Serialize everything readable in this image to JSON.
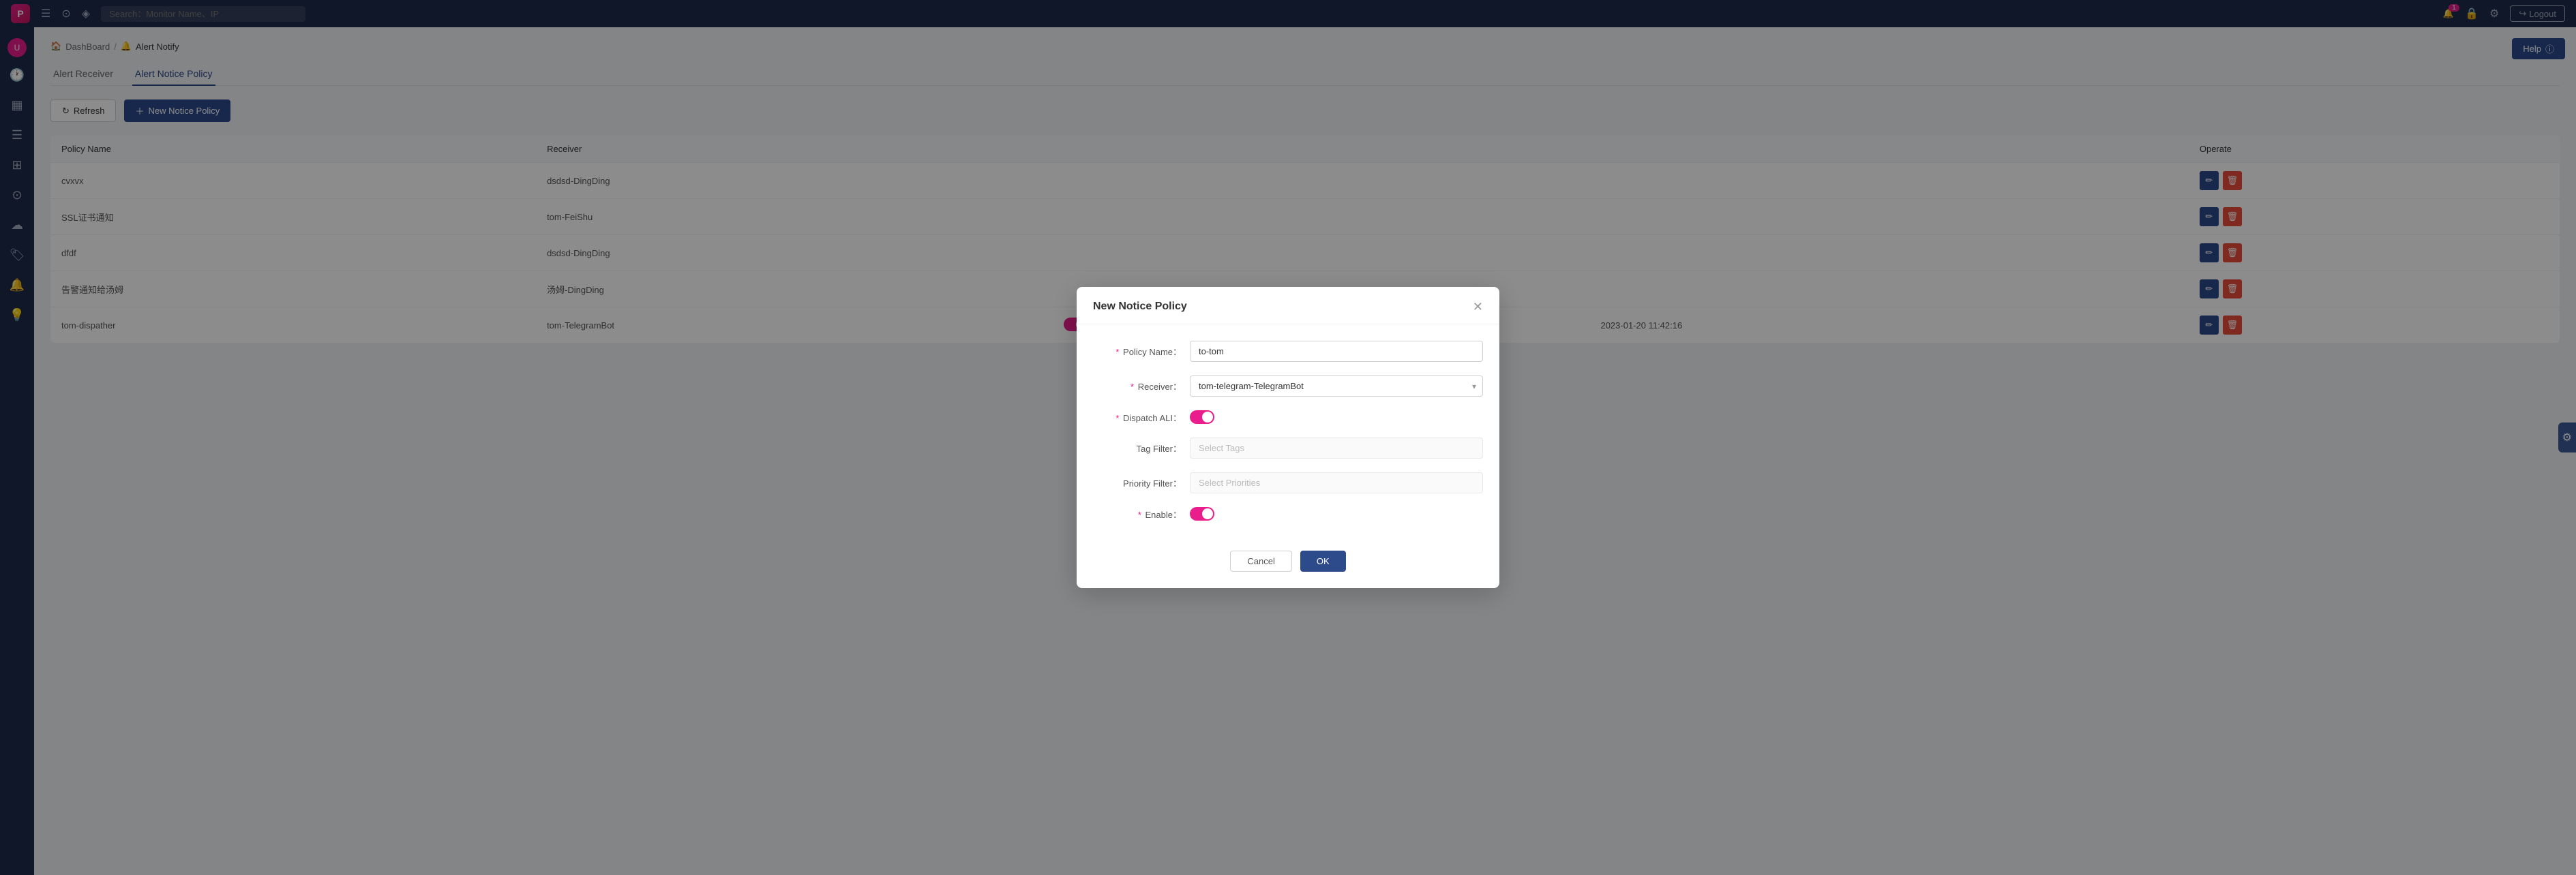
{
  "app": {
    "logo_text": "P",
    "search_placeholder": "Search：Monitor Name、IP"
  },
  "topnav": {
    "bell_badge": "1",
    "logout_label": "Logout"
  },
  "breadcrumb": {
    "home": "DashBoard",
    "current": "Alert Notify"
  },
  "help_button": "Help",
  "tabs": [
    {
      "label": "Alert Receiver",
      "active": false
    },
    {
      "label": "Alert Notice Policy",
      "active": true
    }
  ],
  "actions": {
    "refresh": "Refresh",
    "new": "New Notice Policy"
  },
  "table": {
    "columns": [
      "Policy Name",
      "Receiver",
      "",
      "",
      "",
      "Operate"
    ],
    "rows": [
      {
        "policy_name": "cvxvx",
        "receiver": "dsdsd-DingDing",
        "dispatch": "",
        "filter1": "",
        "filter2": "",
        "date": ""
      },
      {
        "policy_name": "SSL证书通知",
        "receiver": "tom-FeiShu",
        "dispatch": "",
        "filter1": "",
        "filter2": "",
        "date": ""
      },
      {
        "policy_name": "dfdf",
        "receiver": "dsdsd-DingDing",
        "dispatch": "",
        "filter1": "",
        "filter2": "",
        "date": ""
      },
      {
        "policy_name": "告警通知给汤姆",
        "receiver": "汤姆-DingDing",
        "dispatch": "",
        "filter1": "",
        "filter2": "",
        "date": ""
      },
      {
        "policy_name": "tom-dispather",
        "receiver": "tom-TelegramBot",
        "dispatch": "on",
        "filter1": "on",
        "filter2": "",
        "date": "2023-01-20 11:42:16"
      }
    ]
  },
  "modal": {
    "title": "New Notice Policy",
    "fields": {
      "policy_name_label": "Policy Name：",
      "policy_name_value": "to-tom",
      "receiver_label": "Receiver：",
      "receiver_value": "tom-telegram-TelegramBot",
      "dispatch_ali_label": "Dispatch ALI：",
      "tag_filter_label": "Tag Filter：",
      "tag_filter_placeholder": "Select Tags",
      "priority_filter_label": "Priority Filter：",
      "priority_filter_placeholder": "Select Priorities",
      "enable_label": "Enable："
    },
    "cancel_label": "Cancel",
    "ok_label": "OK"
  },
  "sidebar": {
    "items": [
      {
        "icon": "👤",
        "name": "user"
      },
      {
        "icon": "🕐",
        "name": "clock"
      },
      {
        "icon": "▦",
        "name": "grid"
      },
      {
        "icon": "☰",
        "name": "list"
      },
      {
        "icon": "⊞",
        "name": "apps"
      },
      {
        "icon": "⊙",
        "name": "circle"
      },
      {
        "icon": "☁",
        "name": "cloud"
      },
      {
        "icon": "👕",
        "name": "shirt"
      },
      {
        "icon": "🔔",
        "name": "bell"
      },
      {
        "icon": "💡",
        "name": "bulb"
      }
    ]
  },
  "colors": {
    "primary": "#2d4a8a",
    "pink": "#e91e8c",
    "danger": "#e74c3c"
  }
}
